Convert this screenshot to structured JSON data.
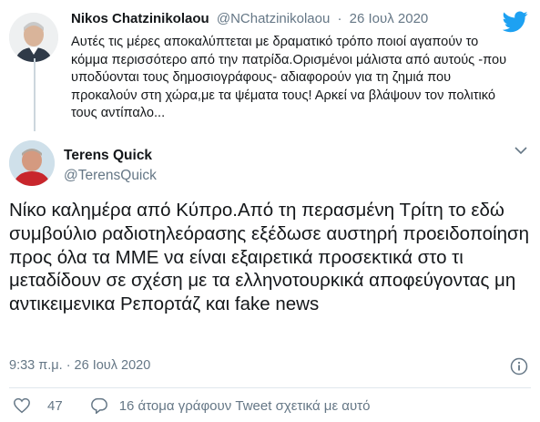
{
  "parent_tweet": {
    "name": "Nikos Chatzinikolaou",
    "handle": "@NChatzinikolaou",
    "separator": "·",
    "date": "26 Ιουλ 2020",
    "text": "Αυτές τις μέρες αποκαλύπτεται με δραματικό τρόπο ποιοί αγαπούν το κόμμα περισσότερο από την πατρίδα.Ορισμένοι μάλιστα από αυτούς -που υποδύονται τους δημοσιογράφους- αδιαφορούν για τη ζημιά που προκαλούν στη χώρα,με τα ψέματα τους! Αρκεί να βλάψουν τον πολιτικό τους αντίπαλο..."
  },
  "main_tweet": {
    "name": "Terens Quick",
    "handle": "@TerensQuick",
    "text": "Νίκο καλημέρα από Κύπρο.Από τη περασμένη Τρίτη το εδώ συμβούλιο ραδιοτηλεόρασης εξέδωσε αυστηρή προειδοποίηση προς όλα τα ΜΜΕ να είναι εξαιρετικά προσεκτικά στο τι μεταδίδουν σε σχέση με τα ελληνοτουρκικά αποφεύγοντας μη αντικειμενικα Ρεπορτάζ και fake news",
    "timestamp": "9:33 π.μ. · 26 Ιουλ 2020",
    "likes": "47",
    "reply_prompt": "16 άτομα γράφουν Tweet σχετικά με αυτό"
  },
  "colors": {
    "twitter_blue": "#1da1f2",
    "secondary_text": "#657786",
    "primary_text": "#14171a"
  },
  "icons": [
    "twitter-bird-icon",
    "chevron-down-icon",
    "info-icon",
    "heart-icon",
    "reply-bubble-icon"
  ]
}
